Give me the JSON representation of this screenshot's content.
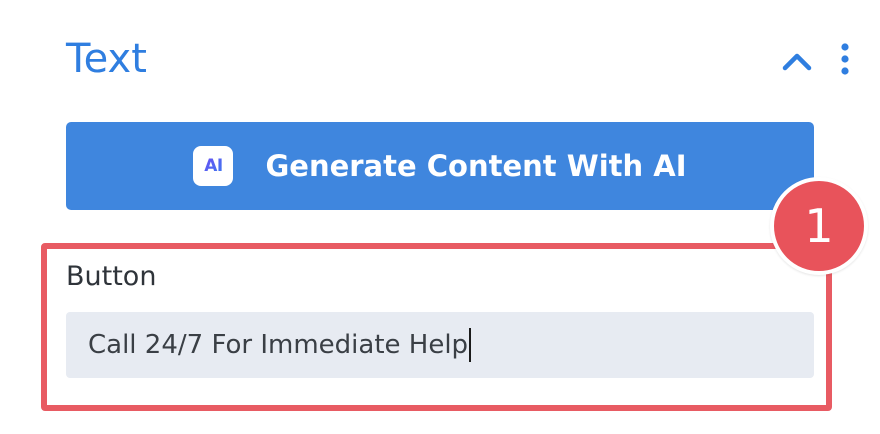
{
  "section": {
    "title": "Text"
  },
  "header_icons": {
    "collapse": "chevron-up-icon",
    "more": "more-vertical-icon"
  },
  "ai_button": {
    "badge_text": "AI",
    "label": "Generate Content With AI"
  },
  "annotation": {
    "step_number": "1"
  },
  "button_field": {
    "label": "Button",
    "value": "Call 24/7 For Immediate Help"
  },
  "colors": {
    "accent": "#2f7ee0",
    "ai_button_bg": "#3f86de",
    "highlight": "#e85b63",
    "input_bg": "#e7ebf2"
  }
}
